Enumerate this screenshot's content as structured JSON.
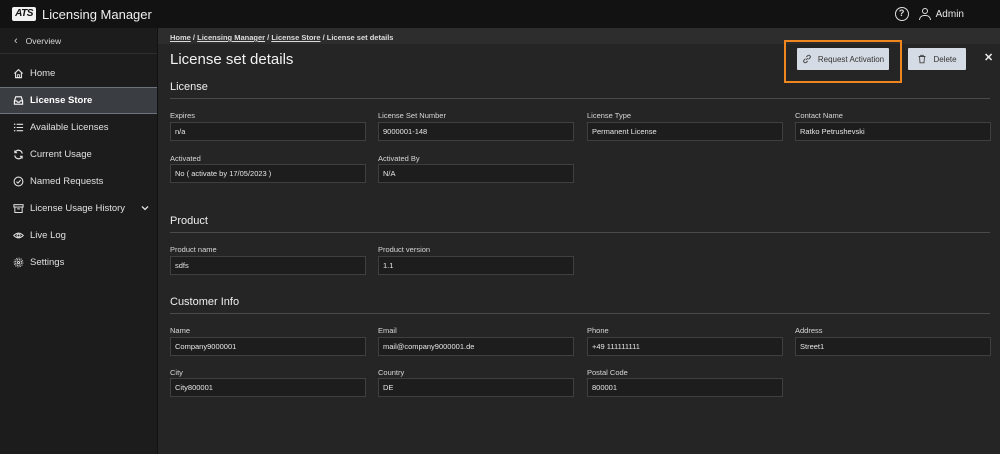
{
  "app": {
    "logo_text": "ATS",
    "title": "Licensing Manager",
    "user": "Admin"
  },
  "sidebar": {
    "overview": "Overview",
    "items": [
      {
        "label": "Home",
        "icon": "home-icon"
      },
      {
        "label": "License Store",
        "icon": "inbox-icon",
        "active": true
      },
      {
        "label": "Available Licenses",
        "icon": "list-icon"
      },
      {
        "label": "Current Usage",
        "icon": "refresh-icon"
      },
      {
        "label": "Named Requests",
        "icon": "check-circle-icon"
      },
      {
        "label": "License Usage History",
        "icon": "archive-icon",
        "expandable": true
      },
      {
        "label": "Live Log",
        "icon": "eye-icon"
      },
      {
        "label": "Settings",
        "icon": "gear-icon"
      }
    ]
  },
  "breadcrumb": {
    "items": [
      "Home",
      "Licensing Manager",
      "License Store"
    ],
    "current": "License set details",
    "separator": " / "
  },
  "page": {
    "title": "License set details",
    "request_activation_label": "Request Activation",
    "delete_label": "Delete",
    "close_label": "✕"
  },
  "license": {
    "title": "License",
    "expires_label": "Expires",
    "expires": "n/a",
    "number_label": "License Set Number",
    "number": "9000001-148",
    "type_label": "License Type",
    "type": "Permanent License",
    "contact_label": "Contact Name",
    "contact": "Ratko Petrushevski",
    "activated_label": "Activated",
    "activated": "No ( activate by 17/05/2023 )",
    "activated_by_label": "Activated By",
    "activated_by": "N/A"
  },
  "product": {
    "title": "Product",
    "name_label": "Product name",
    "name": "sdfs",
    "version_label": "Product version",
    "version": "1.1"
  },
  "customer": {
    "title": "Customer Info",
    "name_label": "Name",
    "name": "Company9000001",
    "email_label": "Email",
    "email": "mail@company9000001.de",
    "phone_label": "Phone",
    "phone": "+49 111111111",
    "address_label": "Address",
    "address": "Street1",
    "city_label": "City",
    "city": "City800001",
    "country_label": "Country",
    "country": "DE",
    "postal_label": "Postal Code",
    "postal": "800001"
  },
  "colors": {
    "highlight": "#f0861e",
    "button_bg": "#d5dbe4",
    "active_nav": "#3a3d42"
  }
}
